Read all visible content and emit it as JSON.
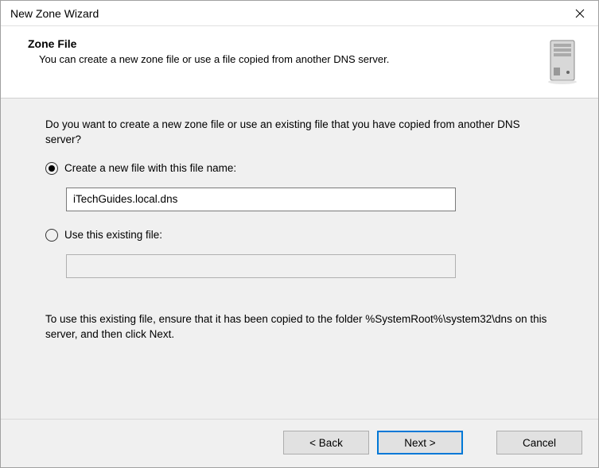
{
  "window": {
    "title": "New Zone Wizard"
  },
  "header": {
    "title": "Zone File",
    "subtitle": "You can create a new zone file or use a file copied from another DNS server."
  },
  "content": {
    "question": "Do you want to create a new zone file or use an existing file that you have copied from another DNS server?",
    "option1_label": "Create a new file with this file name:",
    "option1_value": "iTechGuides.local.dns",
    "option2_label": "Use this existing file:",
    "option2_value": "",
    "help_text": "To use this existing file, ensure that it has been copied to the folder %SystemRoot%\\system32\\dns on this server, and then click Next."
  },
  "buttons": {
    "back": "< Back",
    "next": "Next >",
    "cancel": "Cancel"
  }
}
